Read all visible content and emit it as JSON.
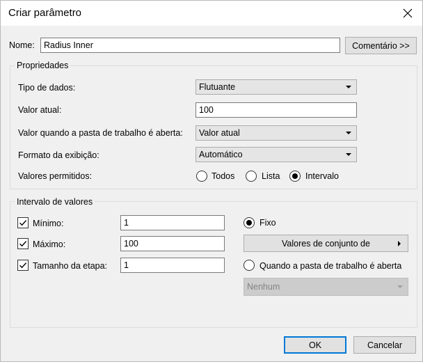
{
  "window": {
    "title": "Criar parâmetro"
  },
  "name": {
    "label": "Nome:",
    "value": "Radius Inner",
    "comment_button": "Comentário >>"
  },
  "properties": {
    "legend": "Propriedades",
    "data_type_label": "Tipo de dados:",
    "data_type_value": "Flutuante",
    "current_value_label": "Valor atual:",
    "current_value": "100",
    "open_value_label": "Valor quando a pasta de trabalho é aberta:",
    "open_value": "Valor atual",
    "display_format_label": "Formato da exibição:",
    "display_format_value": "Automático",
    "allowed_values_label": "Valores permitidos:",
    "allowed_options": [
      "Todos",
      "Lista",
      "Intervalo"
    ],
    "allowed_selected": "Intervalo"
  },
  "range": {
    "legend": "Intervalo de valores",
    "min_label": "Mínimo:",
    "min_value": "1",
    "min_checked": true,
    "max_label": "Máximo:",
    "max_value": "100",
    "max_checked": true,
    "step_label": "Tamanho da etapa:",
    "step_value": "1",
    "step_checked": true,
    "fixed_label": "Fixo",
    "fixed_selected": true,
    "set_from_button": "Valores de conjunto de",
    "when_open_label": "Quando a pasta de trabalho é aberta",
    "when_open_selected": false,
    "when_open_value": "Nenhum"
  },
  "buttons": {
    "ok": "OK",
    "cancel": "Cancelar"
  }
}
